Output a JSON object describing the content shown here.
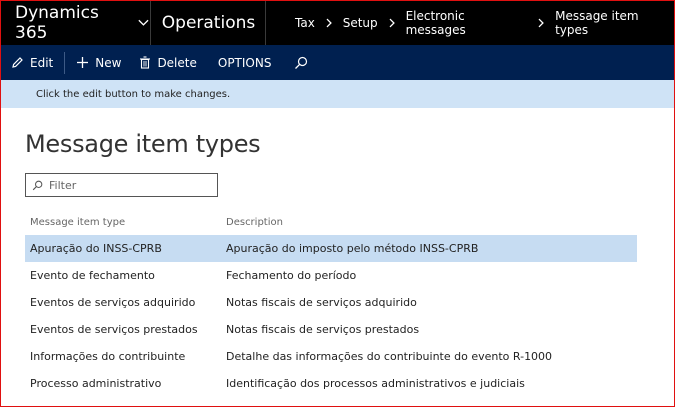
{
  "nav": {
    "app_name": "Dynamics 365",
    "module": "Operations",
    "breadcrumb": [
      "Tax",
      "Setup",
      "Electronic messages",
      "Message item types"
    ]
  },
  "actions": {
    "edit": "Edit",
    "new": "New",
    "delete": "Delete",
    "options": "OPTIONS"
  },
  "message": "Click the edit button to make changes.",
  "page": {
    "title": "Message item types",
    "filter_placeholder": "Filter"
  },
  "grid": {
    "columns": [
      "Message item type",
      "Description"
    ],
    "rows": [
      {
        "type": "Apuração do INSS-CPRB",
        "description": "Apuração do imposto pelo método INSS-CPRB",
        "selected": true
      },
      {
        "type": "Evento de fechamento",
        "description": "Fechamento do período",
        "selected": false
      },
      {
        "type": "Eventos de serviços adquirido",
        "description": "Notas fiscais de serviços adquirido",
        "selected": false
      },
      {
        "type": "Eventos de serviços prestados",
        "description": "Notas fiscais de serviços prestados",
        "selected": false
      },
      {
        "type": "Informações do contribuinte",
        "description": "Detalhe das informações do contribuinte do evento R-1000",
        "selected": false
      },
      {
        "type": "Processo administrativo",
        "description": "Identificação dos processos administrativos e judiciais",
        "selected": false
      }
    ]
  },
  "colors": {
    "nav_bg": "#000000",
    "action_bg": "#002050",
    "message_bg": "#cfe3f6",
    "selected_row": "#c6dcf2",
    "frame_border": "#e01010"
  }
}
